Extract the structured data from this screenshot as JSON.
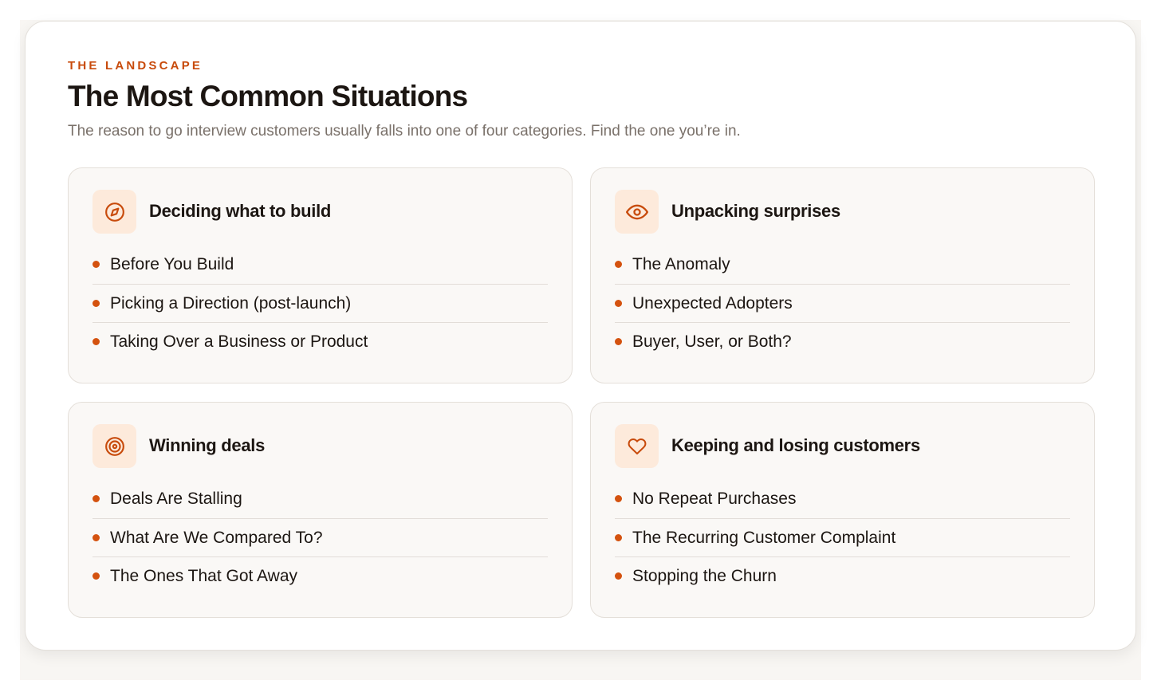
{
  "header": {
    "eyebrow": "THE LANDSCAPE",
    "title": "The Most Common Situations",
    "subtitle": "The reason to go interview customers usually falls into one of four categories. Find the one you’re in."
  },
  "colors": {
    "accent": "#c84b0c",
    "icon_bg": "#fdeadb",
    "card_bg": "#faf8f6",
    "text": "#1c1612",
    "muted": "#7a716a"
  },
  "cards": [
    {
      "icon": "compass-icon",
      "title": "Deciding what to build",
      "items": [
        "Before You Build",
        "Picking a Direction (post-launch)",
        "Taking Over a Business or Product"
      ]
    },
    {
      "icon": "eye-icon",
      "title": "Unpacking surprises",
      "items": [
        "The Anomaly",
        "Unexpected Adopters",
        "Buyer, User, or Both?"
      ]
    },
    {
      "icon": "target-icon",
      "title": "Winning deals",
      "items": [
        "Deals Are Stalling",
        "What Are We Compared To?",
        "The Ones That Got Away"
      ]
    },
    {
      "icon": "heart-icon",
      "title": "Keeping and losing customers",
      "items": [
        "No Repeat Purchases",
        "The Recurring Customer Complaint",
        "Stopping the Churn"
      ]
    }
  ]
}
